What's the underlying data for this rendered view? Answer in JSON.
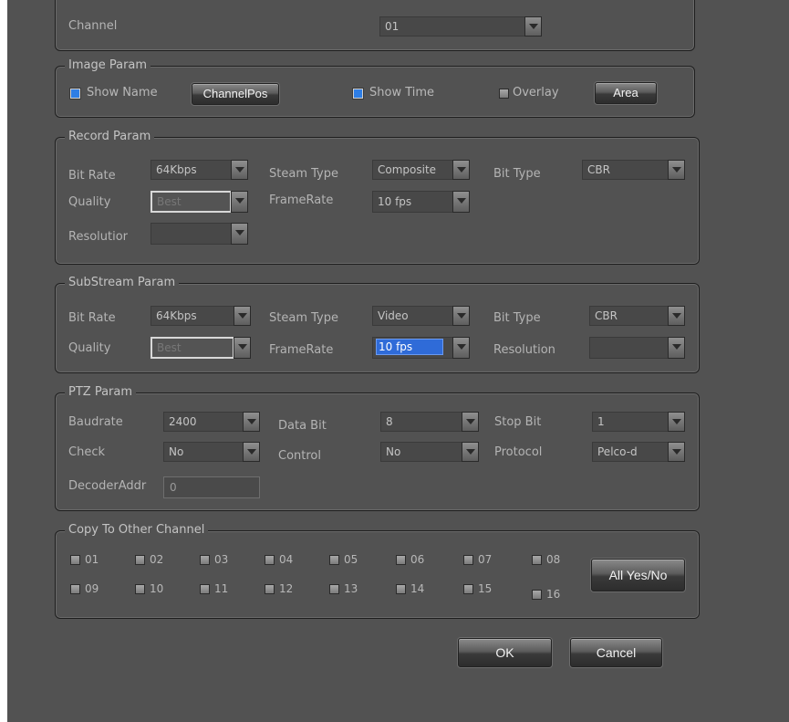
{
  "channel": {
    "label": "Channel",
    "value": "01"
  },
  "image_param": {
    "title": "Image Param",
    "show_name": {
      "label": "Show Name",
      "checked": true
    },
    "channel_pos_button": "ChannelPos",
    "show_time": {
      "label": "Show Time",
      "checked": true
    },
    "overlay": {
      "label": "Overlay",
      "checked": false
    },
    "area_button": "Area"
  },
  "record_param": {
    "title": "Record Param",
    "bit_rate": {
      "label": "Bit Rate",
      "value": "64Kbps"
    },
    "steam_type": {
      "label": "Steam Type",
      "value": "Composite"
    },
    "bit_type": {
      "label": "Bit Type",
      "value": "CBR"
    },
    "quality": {
      "label": "Quality",
      "value": "Best"
    },
    "frame_rate": {
      "label": "FrameRate",
      "value": "10 fps"
    },
    "resolution": {
      "label": "Resolutior",
      "value": ""
    }
  },
  "substream_param": {
    "title": "SubStream Param",
    "bit_rate": {
      "label": "Bit Rate",
      "value": "64Kbps"
    },
    "steam_type": {
      "label": "Steam Type",
      "value": "Video"
    },
    "bit_type": {
      "label": "Bit Type",
      "value": "CBR"
    },
    "quality": {
      "label": "Quality",
      "value": "Best"
    },
    "frame_rate": {
      "label": "FrameRate",
      "value": "10 fps"
    },
    "resolution": {
      "label": "Resolution",
      "value": ""
    }
  },
  "ptz_param": {
    "title": "PTZ Param",
    "baudrate": {
      "label": "Baudrate",
      "value": "2400"
    },
    "data_bit": {
      "label": "Data Bit",
      "value": "8"
    },
    "stop_bit": {
      "label": "Stop Bit",
      "value": "1"
    },
    "check": {
      "label": "Check",
      "value": "No"
    },
    "control": {
      "label": "Control",
      "value": "No"
    },
    "protocol": {
      "label": "Protocol",
      "value": "Pelco-d"
    },
    "decoder_addr": {
      "label": "DecoderAddr",
      "value": "0"
    }
  },
  "copy_to_other_channel": {
    "title": "Copy To Other Channel",
    "channels": [
      "01",
      "02",
      "03",
      "04",
      "05",
      "06",
      "07",
      "08",
      "09",
      "10",
      "11",
      "12",
      "13",
      "14",
      "15",
      "16"
    ],
    "all_button": "All Yes/No"
  },
  "footer": {
    "ok_button": "OK",
    "cancel_button": "Cancel"
  },
  "colors": {
    "background": "#525252",
    "checkbox_on": "#2e7ee6",
    "selection": "#2f6bd8"
  }
}
